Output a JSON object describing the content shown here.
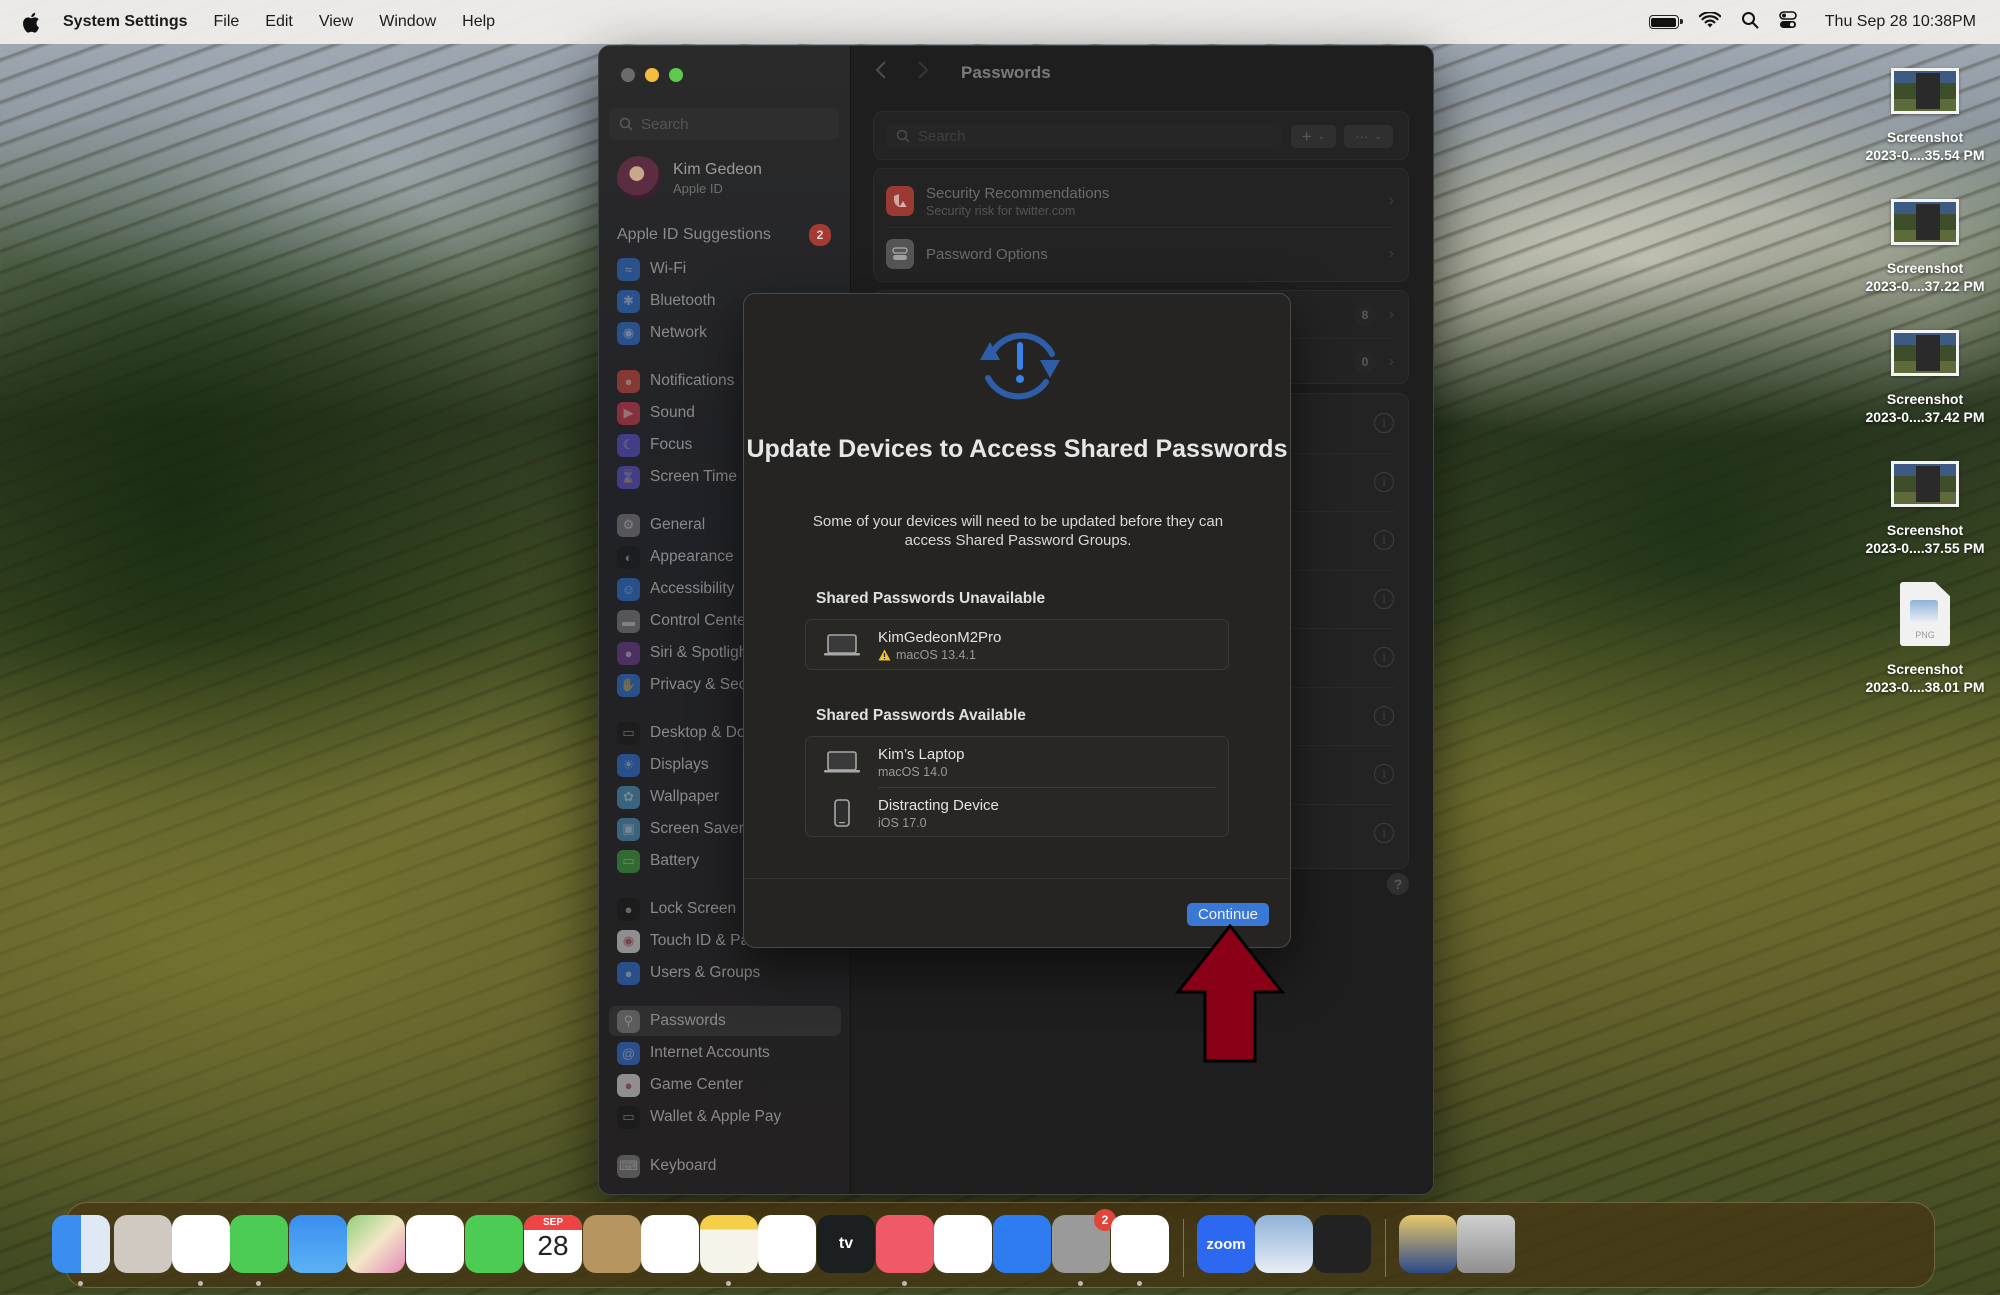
{
  "menubar": {
    "app_name": "System Settings",
    "menus": [
      "File",
      "Edit",
      "View",
      "Window",
      "Help"
    ],
    "clock": "Thu Sep 28  10:38PM",
    "status_icons": [
      "battery-icon",
      "wifi-icon",
      "spotlight-search-icon",
      "control-center-icon"
    ]
  },
  "sidebar": {
    "search_placeholder": "Search",
    "profile": {
      "name": "Kim Gedeon",
      "subtitle": "Apple ID"
    },
    "suggestions": {
      "label": "Apple ID Suggestions",
      "badge": "2"
    },
    "items": [
      {
        "label": "Wi-Fi",
        "icon": "wifi-icon",
        "color": "#2f6fcf"
      },
      {
        "label": "Bluetooth",
        "icon": "bluetooth-icon",
        "color": "#2f6fcf"
      },
      {
        "label": "Network",
        "icon": "globe-icon",
        "color": "#2f6fcf"
      },
      {
        "label": "Notifications",
        "icon": "bell-icon",
        "color": "#c9463d"
      },
      {
        "label": "Sound",
        "icon": "speaker-icon",
        "color": "#c93a4c"
      },
      {
        "label": "Focus",
        "icon": "moon-icon",
        "color": "#5a4fc9"
      },
      {
        "label": "Screen Time",
        "icon": "hourglass-icon",
        "color": "#5a4fc9"
      },
      {
        "label": "General",
        "icon": "gear-icon",
        "color": "#7a7a7a"
      },
      {
        "label": "Appearance",
        "icon": "appearance-icon",
        "color": "#1a1a1a"
      },
      {
        "label": "Accessibility",
        "icon": "accessibility-icon",
        "color": "#2f6fcf"
      },
      {
        "label": "Control Center",
        "icon": "toggles-icon",
        "color": "#7a7a7a"
      },
      {
        "label": "Siri & Spotlight",
        "icon": "siri-icon",
        "color": "#6a3a8a"
      },
      {
        "label": "Privacy & Security",
        "icon": "hand-icon",
        "color": "#2f6fcf"
      },
      {
        "label": "Desktop & Dock",
        "icon": "dock-icon",
        "color": "#1a1a1a"
      },
      {
        "label": "Displays",
        "icon": "sun-icon",
        "color": "#2f6fcf"
      },
      {
        "label": "Wallpaper",
        "icon": "flower-icon",
        "color": "#4a8fb8"
      },
      {
        "label": "Screen Saver",
        "icon": "screensaver-icon",
        "color": "#4a8fb8"
      },
      {
        "label": "Battery",
        "icon": "battery-icon",
        "color": "#3e9a3e"
      },
      {
        "label": "Lock Screen",
        "icon": "lock-icon",
        "color": "#1a1a1a"
      },
      {
        "label": "Touch ID & Password",
        "icon": "fingerprint-icon",
        "color": "#d8d8d8"
      },
      {
        "label": "Users & Groups",
        "icon": "users-icon",
        "color": "#2f6fcf"
      },
      {
        "label": "Passwords",
        "icon": "key-icon",
        "color": "#7a7a7a",
        "active": true
      },
      {
        "label": "Internet Accounts",
        "icon": "at-icon",
        "color": "#2f6fcf"
      },
      {
        "label": "Game Center",
        "icon": "game-center-icon",
        "color": "#d8d8d8"
      },
      {
        "label": "Wallet & Apple Pay",
        "icon": "wallet-icon",
        "color": "#1a1a1a"
      },
      {
        "label": "Keyboard",
        "icon": "keyboard-icon",
        "color": "#7a7a7a"
      }
    ]
  },
  "content": {
    "title": "Passwords",
    "search_placeholder": "Search",
    "add_button": "+",
    "more_button": "···",
    "security": {
      "label": "Security Recommendations",
      "subtitle": "Security risk for twitter.com"
    },
    "options": {
      "label": "Password Options"
    },
    "counts": [
      "8",
      "0"
    ],
    "help": "?"
  },
  "dialog": {
    "title": "Update Devices to Access Shared Passwords",
    "description": "Some of your devices will need to be updated before they can access Shared Password Groups.",
    "unavailable_title": "Shared Passwords Unavailable",
    "unavailable": [
      {
        "name": "KimGedeonM2Pro",
        "os": "macOS 13.4.1",
        "type": "laptop",
        "warning": true
      }
    ],
    "available_title": "Shared Passwords Available",
    "available": [
      {
        "name": "Kim’s Laptop",
        "os": "macOS 14.0",
        "type": "laptop"
      },
      {
        "name": "Distracting Device",
        "os": "iOS 17.0",
        "type": "phone"
      }
    ],
    "continue_label": "Continue",
    "accent": "#3a78d6"
  },
  "annotation": {
    "arrow_color": "#8a0016"
  },
  "desktop": {
    "files": [
      {
        "line1": "Screenshot",
        "line2": "2023-0....35.54 PM",
        "kind": "thumb"
      },
      {
        "line1": "Screenshot",
        "line2": "2023-0....37.22 PM",
        "kind": "thumb"
      },
      {
        "line1": "Screenshot",
        "line2": "2023-0....37.42 PM",
        "kind": "thumb"
      },
      {
        "line1": "Screenshot",
        "line2": "2023-0....37.55 PM",
        "kind": "thumb"
      },
      {
        "line1": "Screenshot",
        "line2": "2023-0....38.01 PM",
        "kind": "png",
        "badge": "PNG"
      }
    ]
  },
  "dock": {
    "apps": [
      {
        "name": "Finder",
        "running": true
      },
      {
        "name": "Launchpad"
      },
      {
        "name": "Safari",
        "running": true
      },
      {
        "name": "Messages",
        "running": true
      },
      {
        "name": "Mail"
      },
      {
        "name": "Maps"
      },
      {
        "name": "Photos"
      },
      {
        "name": "FaceTime"
      },
      {
        "name": "Calendar",
        "month": "SEP",
        "day": "28"
      },
      {
        "name": "Contacts"
      },
      {
        "name": "Reminders"
      },
      {
        "name": "Notes",
        "running": true
      },
      {
        "name": "Freeform"
      },
      {
        "name": "Apple TV",
        "label": "tv"
      },
      {
        "name": "Music",
        "running": true
      },
      {
        "name": "News"
      },
      {
        "name": "App Store"
      },
      {
        "name": "System Settings",
        "badge": "2",
        "running": true
      },
      {
        "name": "Bing",
        "running": true
      },
      {
        "name": "Zoom",
        "label": "zoom"
      },
      {
        "name": "Preview"
      },
      {
        "name": "Clock"
      },
      {
        "name": "Downloads Stack"
      },
      {
        "name": "Trash"
      }
    ]
  }
}
